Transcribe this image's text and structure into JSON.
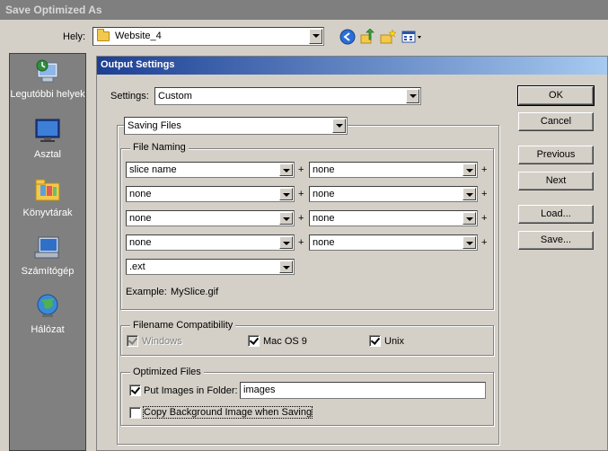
{
  "window": {
    "title": "Save Optimized As"
  },
  "location": {
    "label": "Hely:",
    "value": "Website_4"
  },
  "toolbar_icons": [
    "back-icon",
    "up-folder-icon",
    "new-folder-icon",
    "view-menu-icon"
  ],
  "places": [
    {
      "label": "Legutóbbi helyek",
      "icon": "recent-places-icon"
    },
    {
      "label": "Asztal",
      "icon": "desktop-icon"
    },
    {
      "label": "Könyvtárak",
      "icon": "libraries-icon"
    },
    {
      "label": "Számítógép",
      "icon": "computer-icon"
    },
    {
      "label": "Hálózat",
      "icon": "network-icon"
    }
  ],
  "panel": {
    "title": "Output Settings",
    "settings_label": "Settings:",
    "settings_value": "Custom",
    "section_value": "Saving Files",
    "file_naming": {
      "title": "File Naming",
      "rows": [
        {
          "left": "slice name",
          "right": "none"
        },
        {
          "left": "none",
          "right": "none"
        },
        {
          "left": "none",
          "right": "none"
        },
        {
          "left": "none",
          "right": "none"
        }
      ],
      "plus": "+",
      "extension": ".ext",
      "example_label": "Example:",
      "example_value": "MySlice.gif"
    },
    "compatibility": {
      "title": "Filename Compatibility",
      "windows": {
        "label": "Windows",
        "checked": true,
        "disabled": true
      },
      "macos9": {
        "label": "Mac OS 9",
        "checked": true
      },
      "unix": {
        "label": "Unix",
        "checked": true
      }
    },
    "optimized_files": {
      "title": "Optimized Files",
      "put_images": {
        "label": "Put Images in Folder:",
        "checked": true,
        "folder": "images"
      },
      "copy_background": {
        "label": "Copy Background Image when Saving",
        "checked": false
      }
    }
  },
  "buttons": {
    "ok": "OK",
    "cancel": "Cancel",
    "previous": "Previous",
    "next": "Next",
    "load": "Load...",
    "save": "Save..."
  }
}
